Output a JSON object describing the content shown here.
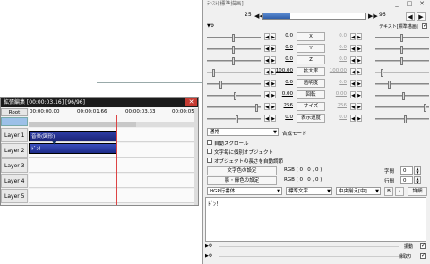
{
  "timeline": {
    "title": "拡張編集 [00:00:03.16] [96/96]",
    "root_label": "Root",
    "ruler": [
      "00:00:00.00",
      "00:00:01.66",
      "00:00:03.33",
      "00:00:05.0"
    ],
    "layers": [
      "Layer 1",
      "Layer 2",
      "Layer 3",
      "Layer 4",
      "Layer 5"
    ],
    "clips": {
      "audio": "音楽(図形)",
      "text": "ﾄﾞﾝ！"
    },
    "playhead_glyph": "▼"
  },
  "text_settings": {
    "title": "ﾃｷｽﾄ[標準描画]",
    "frame_start": "25",
    "frame_end": "96",
    "frame_progress": 0.26,
    "checkbox_text": "テキスト[標準描画]",
    "params": [
      {
        "label": "X",
        "left": "0.0",
        "right": "0.0"
      },
      {
        "label": "Y",
        "left": "0.0",
        "right": "0.0"
      },
      {
        "label": "Z",
        "left": "0.0",
        "right": "0.0"
      },
      {
        "label": "拡大率",
        "left": "100.00",
        "right": "100.00"
      },
      {
        "label": "透明度",
        "left": "0.0",
        "right": "0.0"
      },
      {
        "label": "回転",
        "left": "0.00",
        "right": "0.00"
      },
      {
        "label": "サイズ",
        "left": "256",
        "right": "256"
      },
      {
        "label": "表示速度",
        "left": "0.0",
        "right": "0.0"
      }
    ],
    "blend_mode": "通常",
    "blend_label": "合成モード",
    "opt1": "自動スクロール",
    "opt2": "文字毎に個別オブジェクト",
    "opt3": "オブジェクトの長さを自動調節",
    "color_btn": "文字色の設定",
    "color_val": "RGB ( 0 , 0 , 0 )",
    "shadow_btn": "影・縁色の設定",
    "shadow_val": "RGB ( 0 , 0 , 0 )",
    "char_spacing_label": "字間",
    "char_spacing": "0",
    "line_spacing_label": "行間",
    "line_spacing": "0",
    "font": "HGP行書体",
    "style": "標準文字",
    "align": "中央揃え[中]",
    "bold_btn": "B",
    "italic_btn": "I",
    "detail_btn": "詳細",
    "text": "ﾄﾞﾝ！",
    "filter1": "振動",
    "filter2": "縁取り"
  }
}
